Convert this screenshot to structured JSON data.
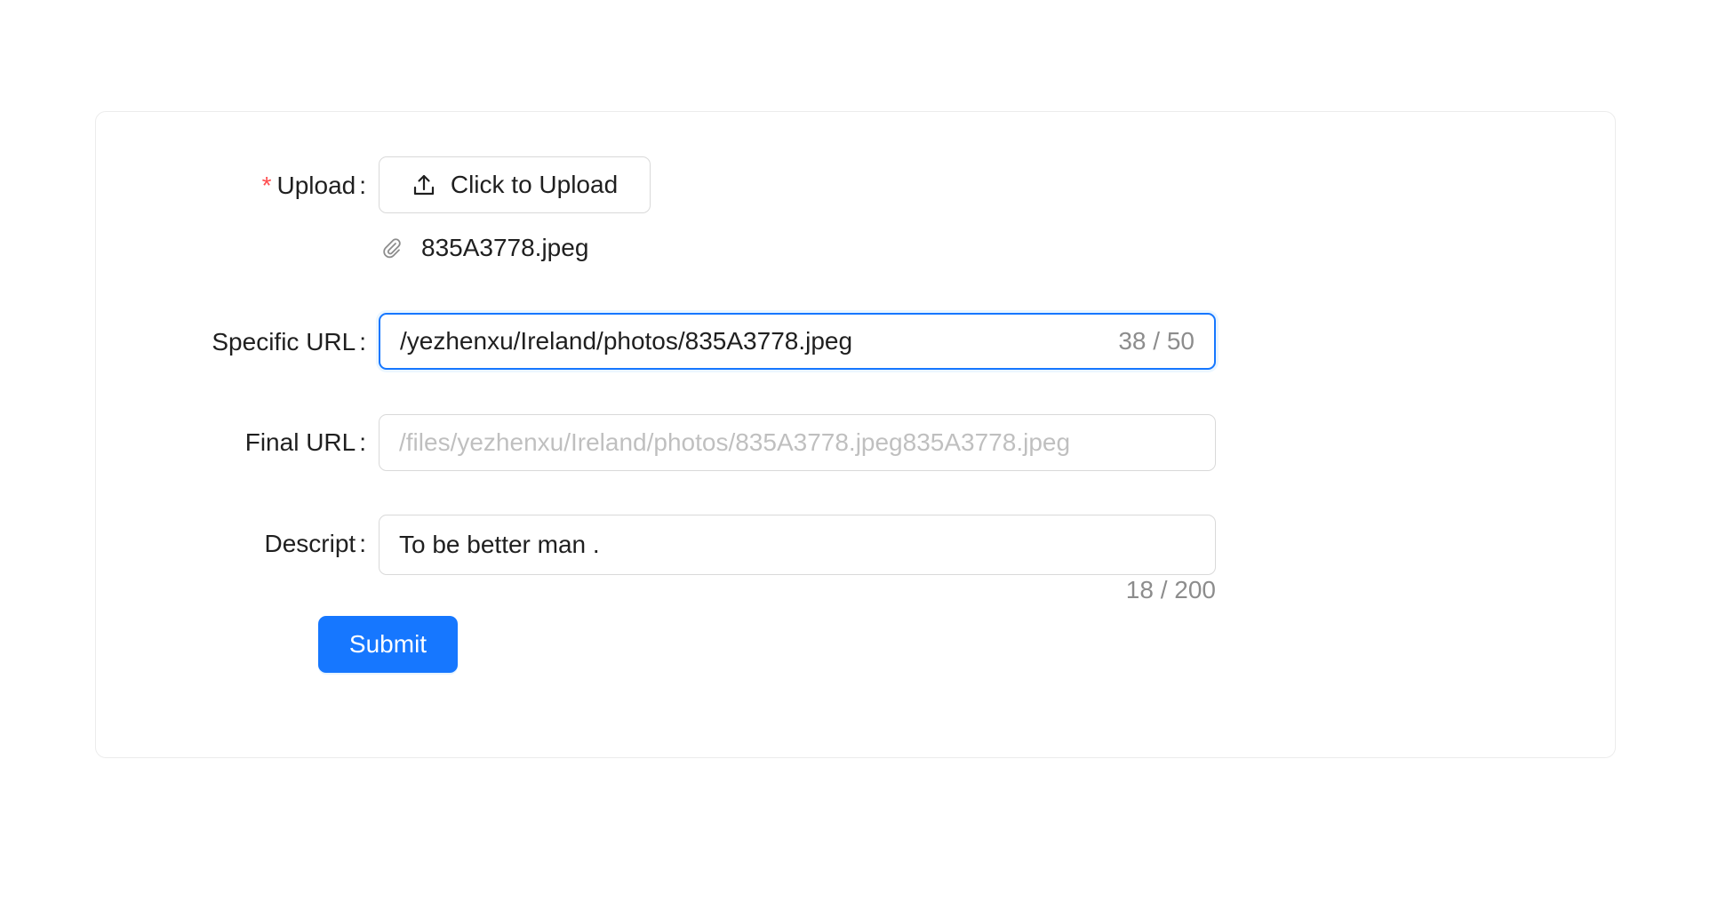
{
  "form": {
    "upload": {
      "label": "Upload",
      "required_mark": "*",
      "button_label": "Click to Upload",
      "button_icon": "upload-icon",
      "file_icon": "paperclip-icon",
      "file_name": "835A3778.jpeg"
    },
    "specific_url": {
      "label": "Specific URL",
      "value": "/yezhenxu/Ireland/photos/835A3778.jpeg",
      "count": "38 / 50"
    },
    "final_url": {
      "label": "Final URL",
      "placeholder": "/files/yezhenxu/Ireland/photos/835A3778.jpeg835A3778.jpeg"
    },
    "descript": {
      "label": "Descript",
      "value": "To be better man .",
      "count": "18 / 200"
    },
    "submit_label": "Submit",
    "colon": ":"
  },
  "colors": {
    "primary": "#1677ff",
    "required": "#ff4d4f"
  }
}
